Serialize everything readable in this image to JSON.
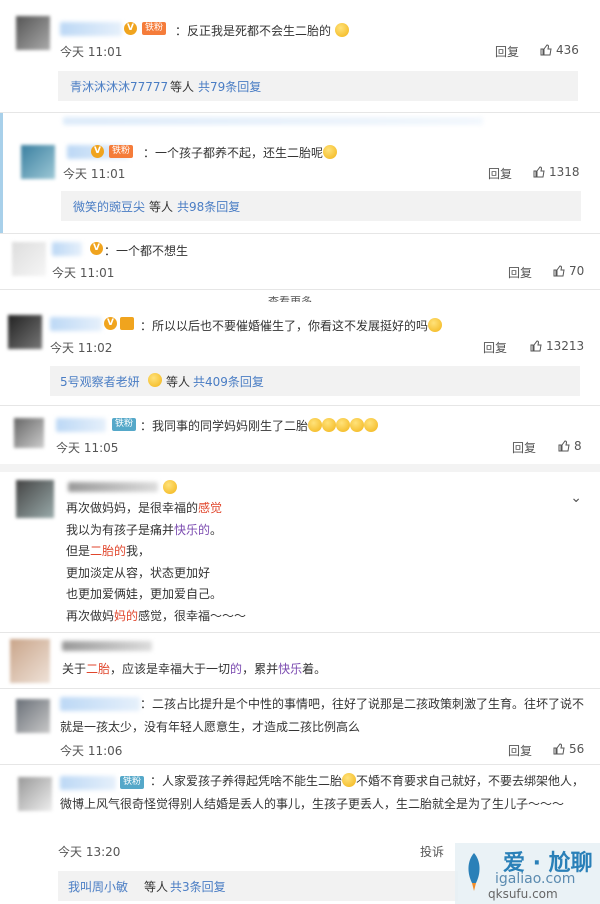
{
  "colors": {
    "link": "#4a7dc4",
    "accent": "#e0462c",
    "vip": "#f0a41e"
  },
  "comments": [
    {
      "text": "：反正我是死都不会生二胎的",
      "time": "今天 11:01",
      "reply": "回复",
      "likes": "436",
      "sub": {
        "user": "青沐沐沐沐77777",
        "mid": "等人",
        "count": "共79条回复"
      },
      "badge": "铁粉"
    },
    {
      "text": "：一个孩子都养不起，还生二胎呢",
      "time": "今天 11:01",
      "reply": "回复",
      "likes": "1318",
      "sub": {
        "user": "微笑的豌豆尖",
        "mid": "等人",
        "count": "共98条回复"
      },
      "badge": "铁粉"
    },
    {
      "text": "：一个都不想生",
      "time": "今天 11:01",
      "reply": "回复",
      "likes": "70"
    },
    {
      "text": "：所以以后也不要催婚催生了，你看这不发展挺好的吗",
      "time": "今天 11:02",
      "reply": "回复",
      "likes": "13213",
      "sub": {
        "user": "5号观察者老妍",
        "mid": "等人",
        "count": "共409条回复"
      }
    },
    {
      "text": "：我同事的同学妈妈刚生了二胎",
      "time": "今天 11:05",
      "reply": "回复",
      "likes": "8",
      "badge": "铁粉"
    }
  ],
  "cut_text": "查看更多",
  "post": {
    "lines": [
      "再次做妈妈，是很幸福的感觉",
      "我以为有孩子是痛并快乐的。",
      "但是二胎的我，",
      "更加淡定从容，状态更加好",
      "也更加爱俩娃，更加爱自己。",
      "再次做妈妈的感觉，很幸福～～～"
    ],
    "caption": "关于二胎，应该是幸福大于一切的，累并快乐着。"
  },
  "comment6": {
    "text": "：二孩占比提升是个中性的事情吧，往好了说那是二孩政策刺激了生育。往坏了说不就是一孩太少，没有年轻人愿意生，才造成二孩比例高么",
    "time": "今天 11:06",
    "reply": "回复",
    "likes": "56"
  },
  "comment7": {
    "badge": "铁粉",
    "text1": "：人家爱孩子养得起凭啥不能生二胎",
    "text2": "不婚不育要求自己就好，不要去绑架他人，微博上风气很奇怪觉得别人结婚是丢人的事儿，生孩子更丢人，生二胎就全是为了生儿子～～～",
    "time": "今天 13:20",
    "report": "投诉",
    "sub": {
      "user": "我叫周小敏",
      "mid": "等人",
      "count": "共3条回复"
    }
  },
  "watermark": {
    "main": "爱 · 尬聊",
    "domain": "igaliao.com",
    "sub": "qksufu.com"
  }
}
